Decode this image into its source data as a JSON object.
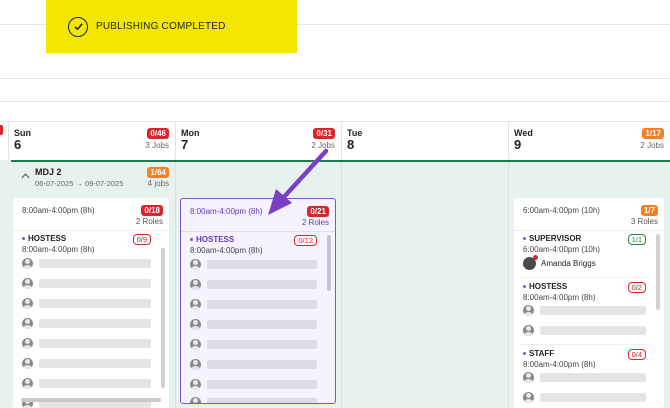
{
  "toast": {
    "message": "PUBLISHING COMPLETED",
    "icon": "check-circle-icon"
  },
  "days": [
    {
      "name": "Sun",
      "num": "6",
      "badge": "0/46",
      "badge_color": "red",
      "jobs": "3 Jobs"
    },
    {
      "name": "Mon",
      "num": "7",
      "badge": "0/31",
      "badge_color": "red",
      "jobs": "2 Jobs"
    },
    {
      "name": "Tue",
      "num": "8"
    },
    {
      "name": "Wed",
      "num": "9",
      "badge": "1/17",
      "badge_color": "orange",
      "jobs": "2 Jobs"
    }
  ],
  "project": {
    "name": "MDJ 2",
    "dates": "06-07-2025 → 09-07-2025",
    "badge": "1/64",
    "jobs": "4 jobs"
  },
  "sun_card": {
    "time": "8:00am-4:00pm (8h)",
    "badge": "0/18",
    "roles": "2 Roles",
    "role": {
      "name": "HOSTESS",
      "time": "8:00am-4:00pm (8h)",
      "badge": "0/9"
    }
  },
  "mon_card": {
    "time": "8:00am-4:00pm (8h)",
    "badge": "0/21",
    "roles": "2 Roles",
    "role": {
      "name": "HOSTESS",
      "time": "8:00am-4:00pm (8h)",
      "badge": "0/12"
    }
  },
  "wed_card": {
    "time": "6:00am-4:00pm (10h)",
    "badge": "1/7",
    "roles": "3 Roles",
    "roles_list": [
      {
        "name": "SUPERVISOR",
        "time": "6:00am-4:00pm (10h)",
        "badge": "1/1",
        "assignee": "Amanda Briggs"
      },
      {
        "name": "HOSTESS",
        "time": "8:00am-4:00pm (8h)",
        "badge": "0/2"
      },
      {
        "name": "STAFF",
        "time": "8:00am-4:00pm (8h)",
        "badge": "0/4"
      }
    ]
  },
  "colors": {
    "toast_bg": "#f3e600",
    "accent_purple": "#7a57d1",
    "badge_red": "#d9252b",
    "badge_orange": "#f2802b",
    "brand_green": "#1e7b4f"
  }
}
